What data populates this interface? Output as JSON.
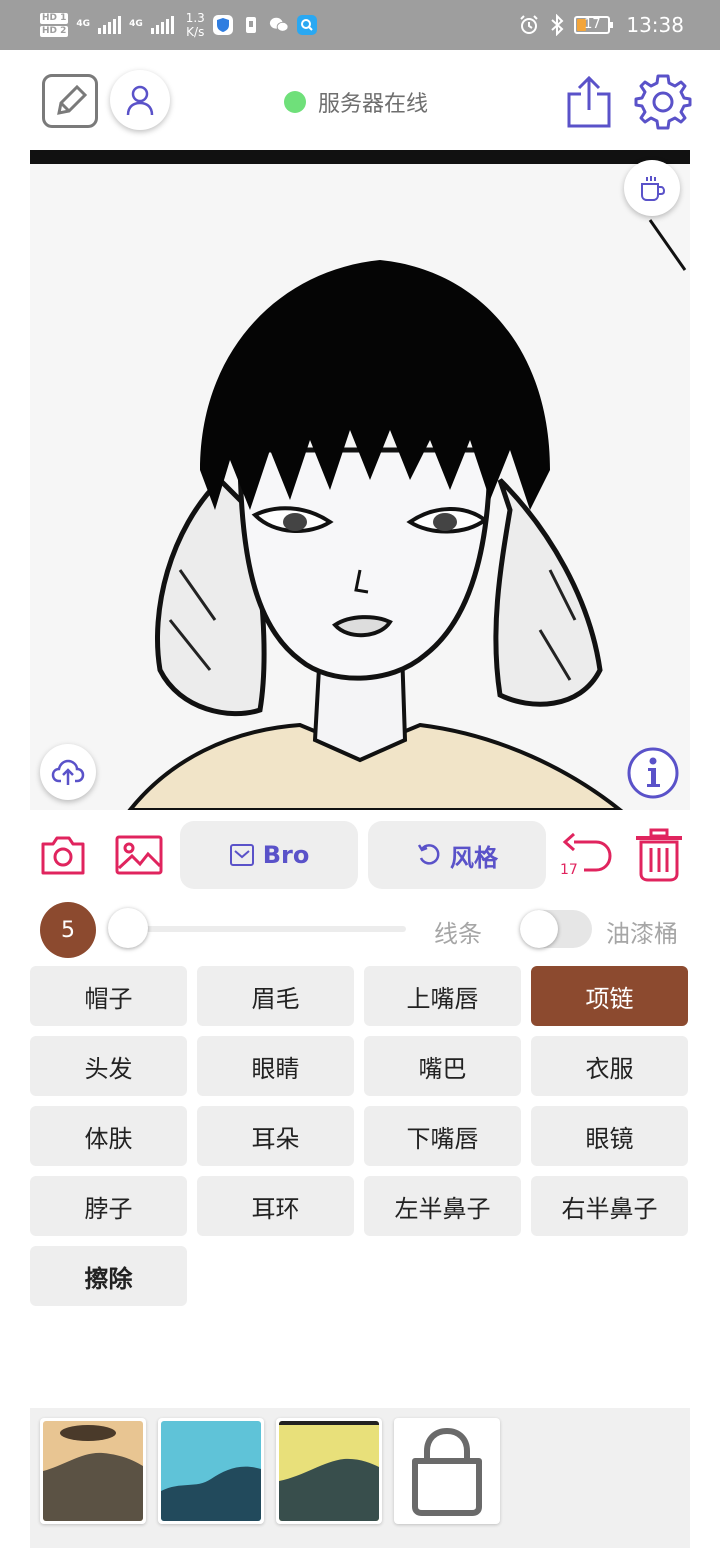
{
  "status_bar": {
    "net_badge_1": "HD 1",
    "net_badge_2": "HD 2",
    "signal_label_1": "4G",
    "signal_label_2": "4G",
    "speed_value": "1.3",
    "speed_unit": "K/s",
    "battery_level": "17",
    "time": "13:38"
  },
  "header": {
    "server_status": "服务器在线",
    "status_color": "#6fe07a"
  },
  "actions": {
    "prompt_button": "Bro",
    "style_button": "风格",
    "undo_count": "17"
  },
  "brush": {
    "size": "5",
    "lines_label": "线条",
    "bucket_label": "油漆桶",
    "size_value": 0.0,
    "bucket_enabled": false
  },
  "labels": [
    {
      "text": "帽子"
    },
    {
      "text": "眉毛"
    },
    {
      "text": "上嘴唇"
    },
    {
      "text": "项链"
    },
    {
      "text": "头发"
    },
    {
      "text": "眼睛"
    },
    {
      "text": "嘴巴"
    },
    {
      "text": "衣服"
    },
    {
      "text": "体肤"
    },
    {
      "text": "耳朵"
    },
    {
      "text": "下嘴唇"
    },
    {
      "text": "眼镜"
    },
    {
      "text": "脖子"
    },
    {
      "text": "耳环"
    },
    {
      "text": "左半鼻子"
    },
    {
      "text": "右半鼻子"
    },
    {
      "text": "擦除"
    }
  ],
  "selected_label": "项链",
  "colors": {
    "accent_red": "#e0245e",
    "accent_blue": "#5a52c9",
    "selected_brown": "#8c4a2f"
  },
  "icons": {
    "edit": "edit-icon",
    "user": "user-icon",
    "share": "share-icon",
    "settings": "gear-icon",
    "coffee": "coffee-icon",
    "upload": "cloud-upload-icon",
    "info": "info-icon",
    "camera": "camera-icon",
    "gallery": "image-icon",
    "undo": "undo-icon",
    "delete": "trash-icon",
    "shop": "shopping-bag-icon"
  }
}
